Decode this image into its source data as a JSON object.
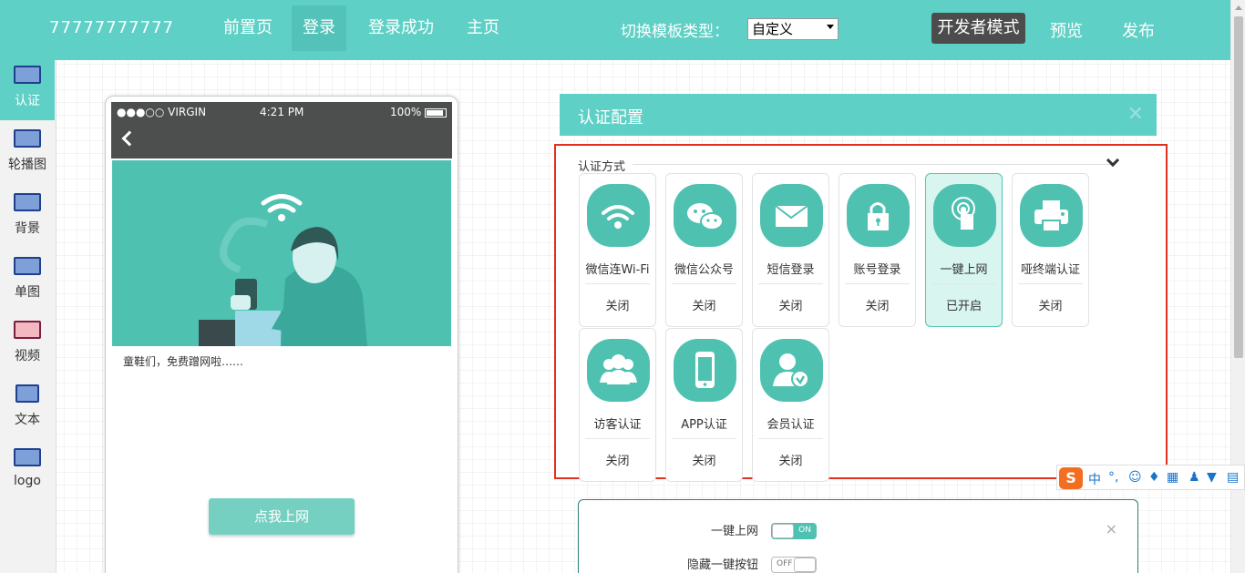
{
  "topbar": {
    "brand": "77777777777",
    "nav": [
      "前置页",
      "登录",
      "登录成功",
      "主页"
    ],
    "template_label": "切换模板类型：",
    "template_value": "自定义",
    "dev_mode": "开发者模式",
    "preview": "预览",
    "publish": "发布"
  },
  "sidebar": {
    "items": [
      {
        "label": "认证",
        "icon": "monitor-icon"
      },
      {
        "label": "轮播图",
        "icon": "monitor-icon"
      },
      {
        "label": "背景",
        "icon": "image-icon"
      },
      {
        "label": "单图",
        "icon": "image-icon"
      },
      {
        "label": "视频",
        "icon": "video-icon"
      },
      {
        "label": "文本",
        "icon": "text-icon"
      },
      {
        "label": "logo",
        "icon": "logo-icon"
      }
    ]
  },
  "phone": {
    "carrier": "●●●○○ VIRGIN",
    "time": "4:21 PM",
    "battery": "100%",
    "caption": "童鞋们，免费蹭网啦……",
    "button": "点我上网"
  },
  "config": {
    "title": "认证配置",
    "legend": "认证方式",
    "methods": [
      {
        "name": "微信连Wi-Fi",
        "status": "关闭",
        "icon": "wifi-icon"
      },
      {
        "name": "微信公众号",
        "status": "关闭",
        "icon": "wechat-icon"
      },
      {
        "name": "短信登录",
        "status": "关闭",
        "icon": "envelope-icon"
      },
      {
        "name": "账号登录",
        "status": "关闭",
        "icon": "lock-icon"
      },
      {
        "name": "一键上网",
        "status": "已开启",
        "icon": "touch-icon"
      },
      {
        "name": "哑终端认证",
        "status": "关闭",
        "icon": "printer-icon"
      },
      {
        "name": "访客认证",
        "status": "关闭",
        "icon": "users-icon"
      },
      {
        "name": "APP认证",
        "status": "关闭",
        "icon": "phone-icon"
      },
      {
        "name": "会员认证",
        "status": "关闭",
        "icon": "member-icon"
      }
    ]
  },
  "detail": {
    "row1_label": "一键上网",
    "row1_toggle": "ON",
    "row2_label": "隐藏一键按钮",
    "row2_toggle": "OFF",
    "close": "×"
  },
  "ime": {
    "logo": "S",
    "lang": "中"
  },
  "colors": {
    "accent": "#5fd0c6",
    "dark": "#4d4f4e",
    "alert_border": "#e0301e"
  }
}
